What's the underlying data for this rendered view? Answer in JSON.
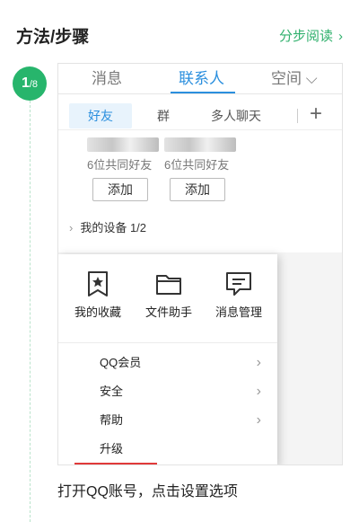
{
  "header": {
    "title": "方法/步骤",
    "link_label": "分步阅读",
    "link_arrow": "›"
  },
  "step": {
    "current": "1",
    "total": "/8"
  },
  "qq": {
    "tabs": [
      "消息",
      "联系人",
      "空间 ⌵"
    ],
    "subtabs": [
      "好友",
      "群",
      "多人聊天"
    ],
    "add_icon": "+",
    "recommendations": [
      {
        "mutual": "6位共同好友",
        "add_label": "添加"
      },
      {
        "mutual": "6位共同好友",
        "add_label": "添加"
      }
    ],
    "groups": [
      {
        "label": "我的设备 1/2"
      }
    ],
    "popup": {
      "icons": [
        {
          "icon": "star-bookmark-icon",
          "label": "我的收藏"
        },
        {
          "icon": "folder-icon",
          "label": "文件助手"
        },
        {
          "icon": "message-icon",
          "label": "消息管理"
        }
      ],
      "items": [
        {
          "label": "QQ会员",
          "chevron": "›"
        },
        {
          "label": "安全",
          "chevron": "›"
        },
        {
          "label": "帮助",
          "chevron": "›"
        },
        {
          "label": "升级",
          "chevron": ""
        }
      ],
      "underline_color": "#e03a3a"
    }
  },
  "caption": "打开QQ账号，点击设置选项",
  "colors": {
    "accent": "#27b56c",
    "qq_blue": "#2b8fde"
  }
}
